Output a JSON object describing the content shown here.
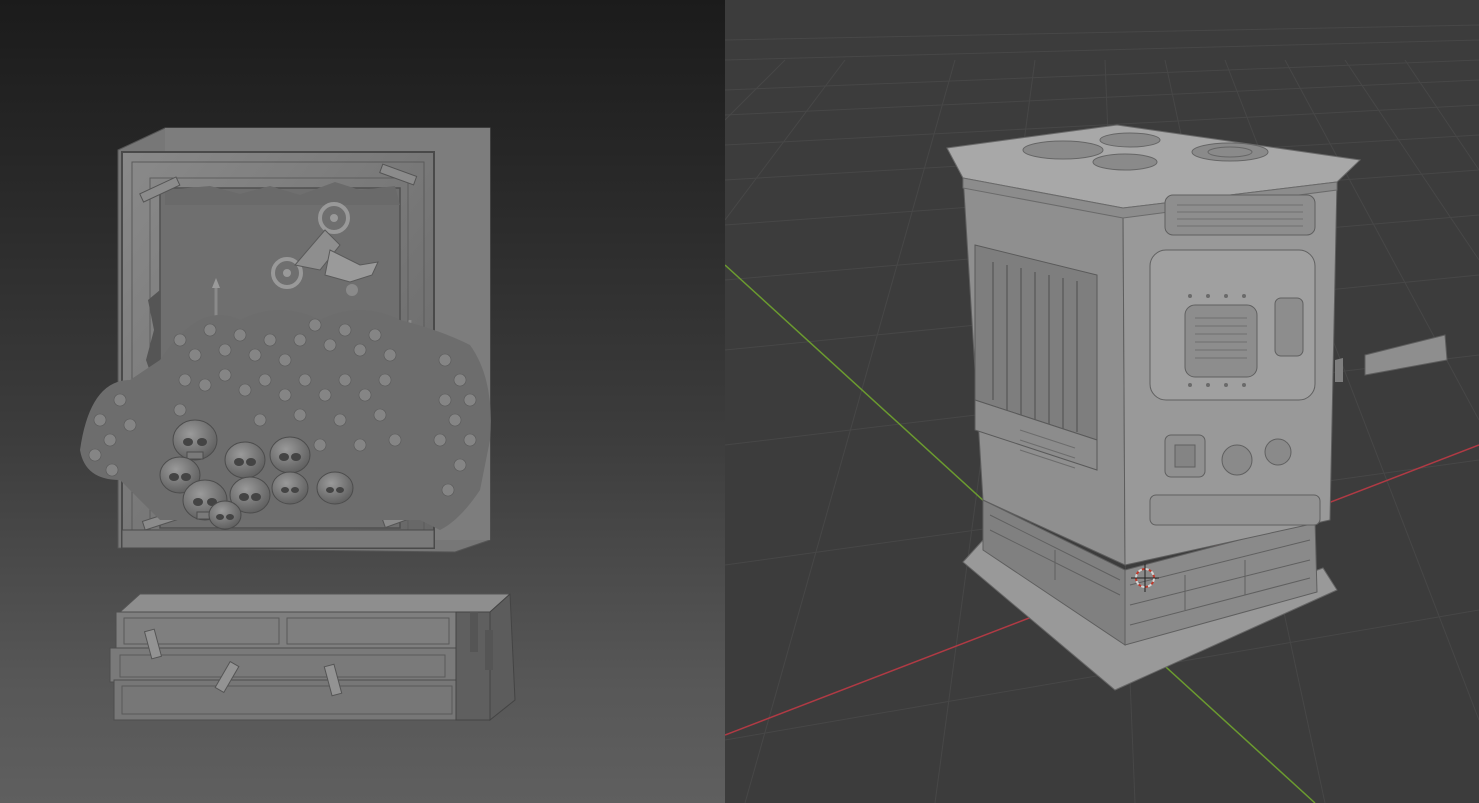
{
  "left_viewport": {
    "name": "sculpt-viewport",
    "background_top": "#1b1b1b",
    "background_bottom": "#5f5f5f",
    "model_color": "#7a7a7a",
    "objects": [
      "diorama-frame-model",
      "base-crate-model"
    ]
  },
  "right_viewport": {
    "name": "3d-viewport",
    "background": "#3c3c3c",
    "grid_color": "#4a4a4a",
    "x_axis_color": "#b03a44",
    "y_axis_color": "#6b9b2f",
    "model_color": "#8c8c8c",
    "objects": [
      "machine-cabinet-model",
      "3d-cursor"
    ]
  }
}
